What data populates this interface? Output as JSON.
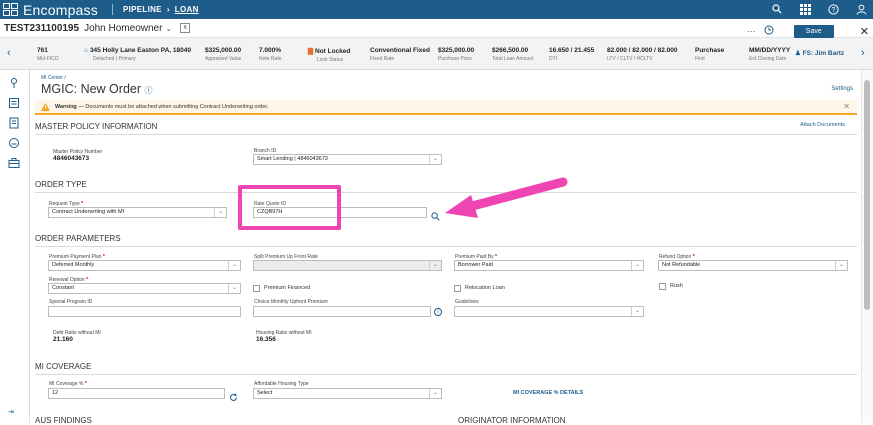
{
  "topbar": {
    "brand": "Encompass",
    "crumb_pipeline": "PIPELINE",
    "crumb_sep": "›",
    "crumb_loan": "LOAN"
  },
  "loanbar": {
    "loan_number": "TEST231100195",
    "borrower": "John Homeowner",
    "chevron": "⌄",
    "box_glyph": "x",
    "dots": "···",
    "save_label": "Save",
    "close": "✕"
  },
  "summary": {
    "fico": {
      "value": "761",
      "label": "Mid-FICO"
    },
    "address": {
      "value": "345 Holly Lane Easton PA, 18040",
      "label": "Detached | Primary"
    },
    "appraised": {
      "value": "$325,000.00",
      "label": "Appraised Value"
    },
    "rate": {
      "value": "7.000%",
      "label": "Note Rate"
    },
    "lock": {
      "value": "Not Locked",
      "label": "Lock Status"
    },
    "product": {
      "value": "Conventional Fixed",
      "label": "Fixed Rate"
    },
    "price": {
      "value": "$325,000.00",
      "label": "Purchase Price"
    },
    "loan_amount": {
      "value": "$266,500.00",
      "label": "Total Loan Amount"
    },
    "dti": {
      "value": "16.650 / 21.455",
      "label": "DTI"
    },
    "ltv": {
      "value": "82.000 / 82.000 / 82.000",
      "label": "LTV / CLTV / HCLTV"
    },
    "purpose": {
      "value": "Purchase",
      "label": "First"
    },
    "closing": {
      "value": "MM/DD/YYYY",
      "label": "Est Closing Date"
    },
    "fs": "FS: Jim Bartz"
  },
  "page": {
    "breadcrumb": "MI Center /",
    "title": "MGIC: New Order",
    "settings": "Settings"
  },
  "warning": {
    "bold": "Warning",
    "text": " — Documents must be attached when submitting Contract Underwriting order.",
    "close": "✕"
  },
  "master": {
    "header": "MASTER POLICY INFORMATION",
    "attach": "Attach Documents",
    "policy_label": "Master Policy Number",
    "policy_value": "4846043673",
    "branch_label": "Branch ID",
    "branch_value": "Smart Lending | 4846043673"
  },
  "order_type": {
    "header": "ORDER TYPE",
    "request_label": "Request Type",
    "request_value": "Contract Underwriting with MI",
    "rate_quote_label": "Rate Quote ID",
    "rate_quote_value": "CZQB97H"
  },
  "params": {
    "header": "ORDER PARAMETERS",
    "premium_plan_label": "Premium Payment Plan",
    "premium_plan_value": "Deferred Monthly",
    "split_label": "Split Premium Up Front Rate",
    "split_value": "",
    "paid_by_label": "Premium Paid By",
    "paid_by_value": "Borrower Paid",
    "refund_label": "Refund Option",
    "refund_value": "Not Refundable",
    "renewal_label": "Renewal Option",
    "renewal_value": "Constant",
    "financed_label": "Premium Financed",
    "relocation_label": "Relocation Loan",
    "rush_label": "Rush",
    "special_label": "Special Program ID",
    "special_value": "",
    "choice_label": "Choice Monthly Upfront Premium",
    "choice_value": "",
    "guidelines_label": "Guidelines",
    "guidelines_value": "",
    "debt_ratio_label": "Debt Ratio without MI",
    "debt_ratio_value": "21.160",
    "housing_ratio_label": "Housing Ratio without MI",
    "housing_ratio_value": "16.356"
  },
  "coverage": {
    "header": "MI COVERAGE",
    "pct_label": "MI Coverage %",
    "pct_value": "12",
    "afford_label": "Affordable Housing Type",
    "afford_value": "Select",
    "details_link": "MI COVERAGE % DETAILS"
  },
  "bottom": {
    "aus": "AUS FINDINGS",
    "originator": "ORIGINATOR INFORMATION"
  },
  "colors": {
    "brand": "#1e5c8a",
    "highlight": "#ee44b4",
    "warning": "#f5a623"
  }
}
